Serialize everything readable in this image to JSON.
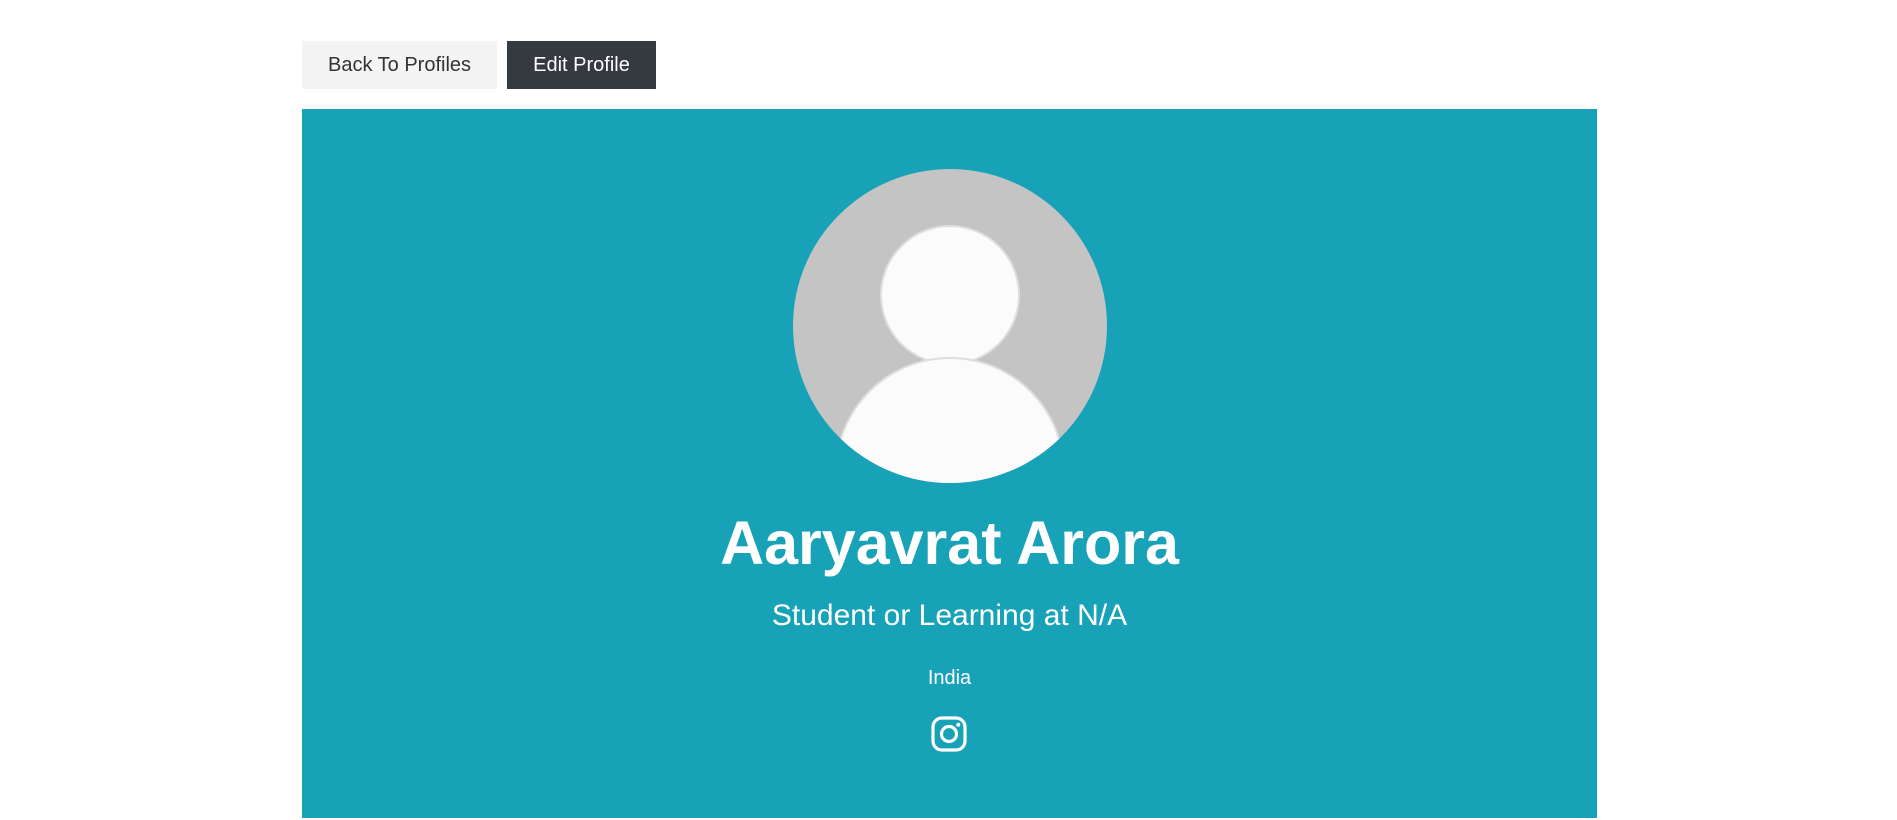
{
  "actions": {
    "back_label": "Back To Profiles",
    "edit_label": "Edit Profile"
  },
  "profile": {
    "name": "Aaryavrat Arora",
    "status": "Student or Learning at N/A",
    "location": "India",
    "social": [
      {
        "icon": "instagram-icon"
      }
    ]
  },
  "colors": {
    "accent": "#17a2b8",
    "dark_button": "#343a40",
    "light_button": "#f4f4f4",
    "avatar_bg": "#c4c4c4"
  }
}
